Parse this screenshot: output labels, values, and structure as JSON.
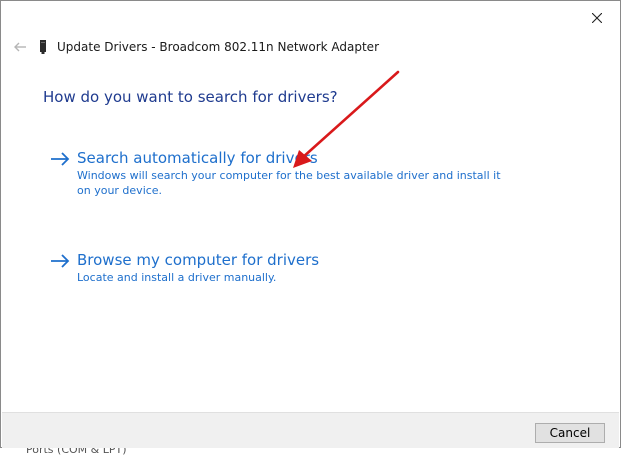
{
  "window": {
    "title": "Update Drivers - Broadcom 802.11n Network Adapter",
    "close_icon": "close-icon",
    "back_icon": "back-arrow-icon",
    "device_icon": "network-adapter-icon"
  },
  "heading": "How do you want to search for drivers?",
  "options": [
    {
      "title": "Search automatically for drivers",
      "description": "Windows will search your computer for the best available driver and install it on your device.",
      "icon": "arrow-right-icon"
    },
    {
      "title": "Browse my computer for drivers",
      "description": "Locate and install a driver manually.",
      "icon": "arrow-right-icon"
    }
  ],
  "footer": {
    "cancel_label": "Cancel"
  },
  "background": {
    "partial_text": "Ports (COM & LPT)"
  },
  "colors": {
    "heading": "#1f3b8f",
    "link": "#1e6fcc",
    "annotation_arrow": "#d9191b",
    "footer_bg": "#f0f0f0"
  }
}
